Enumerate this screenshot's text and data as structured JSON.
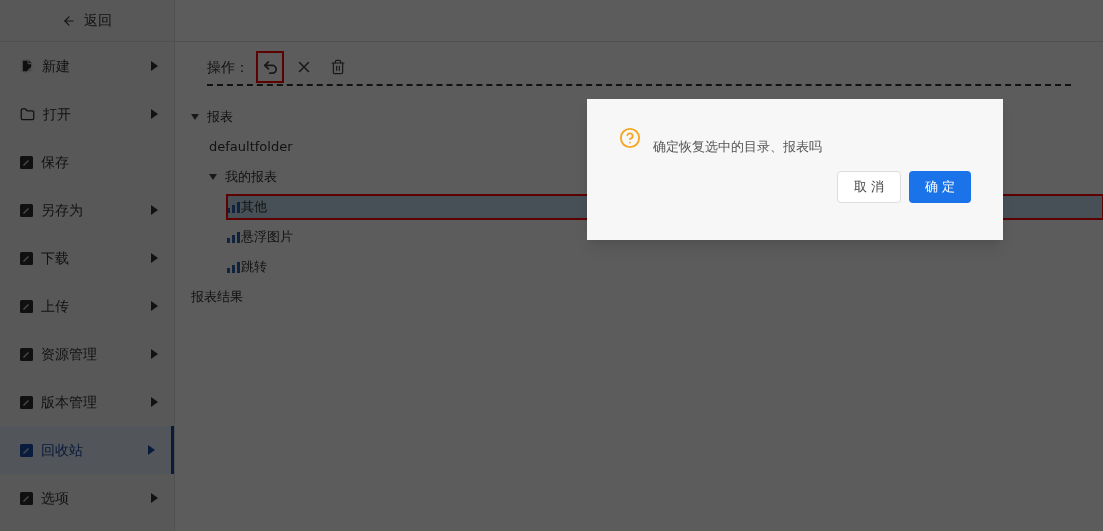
{
  "sidebar": {
    "back": {
      "label": "返回"
    },
    "items": [
      {
        "label": "新建",
        "kind": "new",
        "has_submenu": true,
        "selected": false
      },
      {
        "label": "打开",
        "kind": "open",
        "has_submenu": true,
        "selected": false
      },
      {
        "label": "保存",
        "kind": "doc",
        "has_submenu": false,
        "selected": false
      },
      {
        "label": "另存为",
        "kind": "doc",
        "has_submenu": true,
        "selected": false
      },
      {
        "label": "下载",
        "kind": "doc",
        "has_submenu": true,
        "selected": false
      },
      {
        "label": "上传",
        "kind": "doc",
        "has_submenu": true,
        "selected": false
      },
      {
        "label": "资源管理",
        "kind": "doc",
        "has_submenu": true,
        "selected": false
      },
      {
        "label": "版本管理",
        "kind": "doc",
        "has_submenu": true,
        "selected": false
      },
      {
        "label": "回收站",
        "kind": "doc",
        "has_submenu": true,
        "selected": true
      },
      {
        "label": "选项",
        "kind": "doc",
        "has_submenu": true,
        "selected": false
      }
    ]
  },
  "toolbar": {
    "label": "操作：",
    "actions": [
      {
        "kind": "restore",
        "highlighted": true
      },
      {
        "kind": "delete",
        "highlighted": false
      },
      {
        "kind": "trash",
        "highlighted": false
      }
    ]
  },
  "tree": [
    {
      "label": "报表",
      "kind": "folder",
      "expanded": true,
      "selected": false,
      "highlighted": false,
      "children": [
        {
          "label": "defaultfolder",
          "kind": "folder",
          "selected": false,
          "highlighted": false
        },
        {
          "label": "我的报表",
          "kind": "folder",
          "expanded": true,
          "selected": false,
          "highlighted": false,
          "children": [
            {
              "label": "其他",
              "kind": "report",
              "selected": true,
              "highlighted": true
            },
            {
              "label": "悬浮图片",
              "kind": "report",
              "selected": false,
              "highlighted": false
            },
            {
              "label": "跳转",
              "kind": "report",
              "selected": false,
              "highlighted": false
            }
          ]
        }
      ]
    },
    {
      "label": "报表结果",
      "kind": "folder",
      "selected": false,
      "highlighted": false
    }
  ],
  "dialog": {
    "message": "确定恢复选中的目录、报表吗",
    "buttons": [
      {
        "label": "取 消",
        "kind": "secondary"
      },
      {
        "label": "确 定",
        "kind": "primary"
      }
    ]
  }
}
